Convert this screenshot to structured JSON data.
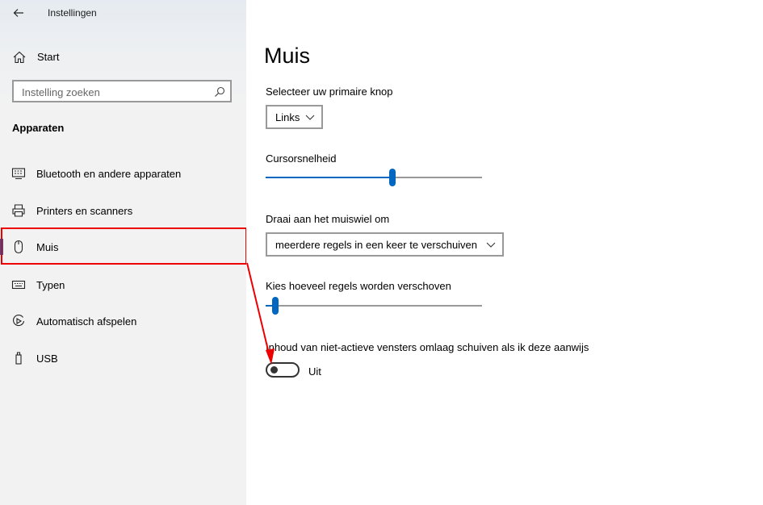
{
  "window": {
    "title": "Instellingen"
  },
  "sidebar": {
    "home_label": "Start",
    "search": {
      "placeholder": "Instelling zoeken",
      "value": ""
    },
    "section_title": "Apparaten",
    "items": [
      {
        "label": "Bluetooth en andere apparaten",
        "icon": "bluetooth-devices-icon"
      },
      {
        "label": "Printers en scanners",
        "icon": "printer-icon"
      },
      {
        "label": "Muis",
        "icon": "mouse-icon",
        "selected": true
      },
      {
        "label": "Typen",
        "icon": "keyboard-icon"
      },
      {
        "label": "Automatisch afspelen",
        "icon": "autoplay-icon"
      },
      {
        "label": "USB",
        "icon": "usb-icon"
      }
    ]
  },
  "main": {
    "title": "Muis",
    "primary_button": {
      "label": "Selecteer uw primaire knop",
      "value": "Links"
    },
    "cursor_speed": {
      "label": "Cursorsnelheid",
      "value_fraction": 0.57
    },
    "wheel_scroll": {
      "label": "Draai aan het muiswiel om",
      "value": "meerdere regels in een keer te verschuiven"
    },
    "lines_to_scroll": {
      "label": "Kies hoeveel regels worden verschoven",
      "value_fraction": 0.03
    },
    "inactive_scroll": {
      "label": "Inhoud van niet-actieve vensters omlaag schuiven als ik deze aanwijs",
      "state_label": "Uit",
      "on": false
    }
  },
  "colors": {
    "accent": "#0067c0",
    "highlight": "#e00000",
    "sidebar_bg": "#f2f2f2"
  }
}
